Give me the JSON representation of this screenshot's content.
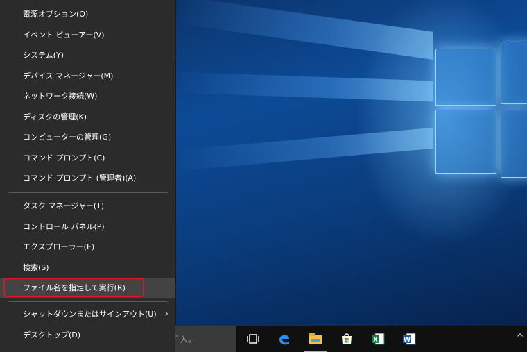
{
  "menu": {
    "group1": [
      {
        "label": "電源オプション(O)",
        "key": "power-options"
      },
      {
        "label": "イベント ビューアー(V)",
        "key": "event-viewer"
      },
      {
        "label": "システム(Y)",
        "key": "system"
      },
      {
        "label": "デバイス マネージャー(M)",
        "key": "device-manager"
      },
      {
        "label": "ネットワーク接続(W)",
        "key": "network-connections"
      },
      {
        "label": "ディスクの管理(K)",
        "key": "disk-management"
      },
      {
        "label": "コンピューターの管理(G)",
        "key": "computer-management"
      },
      {
        "label": "コマンド プロンプト(C)",
        "key": "command-prompt"
      },
      {
        "label": "コマンド プロンプト (管理者)(A)",
        "key": "command-prompt-admin"
      }
    ],
    "group2": [
      {
        "label": "タスク マネージャー(T)",
        "key": "task-manager"
      },
      {
        "label": "コントロール パネル(P)",
        "key": "control-panel"
      },
      {
        "label": "エクスプローラー(E)",
        "key": "explorer"
      },
      {
        "label": "検索(S)",
        "key": "search"
      },
      {
        "label": "ファイル名を指定して実行(R)",
        "key": "run",
        "selected": true
      }
    ],
    "group3": [
      {
        "label": "シャットダウンまたはサインアウト(U)",
        "key": "shutdown-signout",
        "submenu": true
      },
      {
        "label": "デスクトップ(D)",
        "key": "desktop"
      }
    ],
    "highlight_color": "#e0141e"
  },
  "taskbar": {
    "search_fragment": "ﾞ入。",
    "icons": [
      "task-view-icon",
      "edge-icon",
      "file-explorer-icon",
      "store-icon",
      "excel-icon",
      "word-icon"
    ],
    "tray_chevron": "^"
  }
}
